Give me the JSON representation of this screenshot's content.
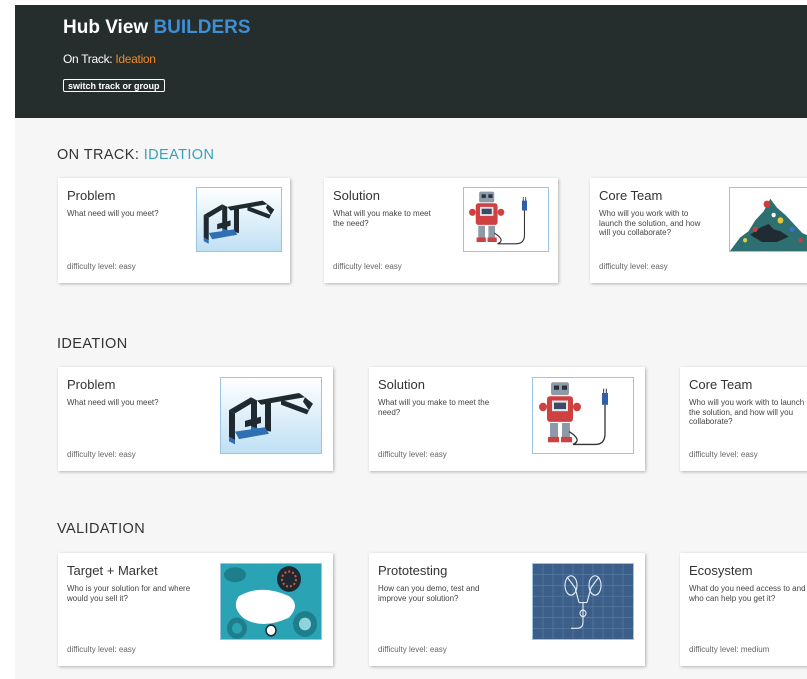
{
  "header": {
    "title_main": "Hub View",
    "title_accent": "BUILDERS",
    "track_label": "On Track:",
    "track_value": "Ideation",
    "switch_button": "switch track or group"
  },
  "sections": {
    "on_track": {
      "title_prefix": "ON TRACK:",
      "title_highlight": "IDEATION",
      "cards": [
        {
          "title": "Problem",
          "description": "What need will you meet?",
          "difficulty": "difficulty level: easy",
          "image": "frame-structure"
        },
        {
          "title": "Solution",
          "description": "What will you make to meet the need?",
          "difficulty": "difficulty level: easy",
          "image": "robot"
        },
        {
          "title": "Core Team",
          "description": "Who will you work with to launch the solution, and how will you collaborate?",
          "difficulty": "difficulty level: easy",
          "image": "toy-pile"
        }
      ]
    },
    "ideation": {
      "title": "IDEATION",
      "cards": [
        {
          "title": "Problem",
          "description": "What need will you meet?",
          "difficulty": "difficulty level: easy",
          "image": "frame-structure"
        },
        {
          "title": "Solution",
          "description": "What will you make to meet the need?",
          "difficulty": "difficulty level: easy",
          "image": "robot"
        },
        {
          "title": "Core Team",
          "description": "Who will you work with to launch the solution, and how will you collaborate?",
          "difficulty": "difficulty level: easy",
          "image": "toy-pile"
        }
      ]
    },
    "validation": {
      "title": "VALIDATION",
      "cards": [
        {
          "title": "Target + Market",
          "description": "Who is your solution for and where would you sell it?",
          "difficulty": "difficulty level: easy",
          "image": "market-collage"
        },
        {
          "title": "Prototesting",
          "description": "How can you demo, test and improve your solution?",
          "difficulty": "difficulty level: easy",
          "image": "blueprint"
        },
        {
          "title": "Ecosystem",
          "description": "What do you need access to and who can help you get it?",
          "difficulty": "difficulty level: medium",
          "image": "none"
        }
      ]
    }
  },
  "colors": {
    "header_bg": "#252d2d",
    "accent_blue": "#3d8fd6",
    "track_orange": "#f08a24",
    "section_highlight": "#3aa0b8"
  }
}
